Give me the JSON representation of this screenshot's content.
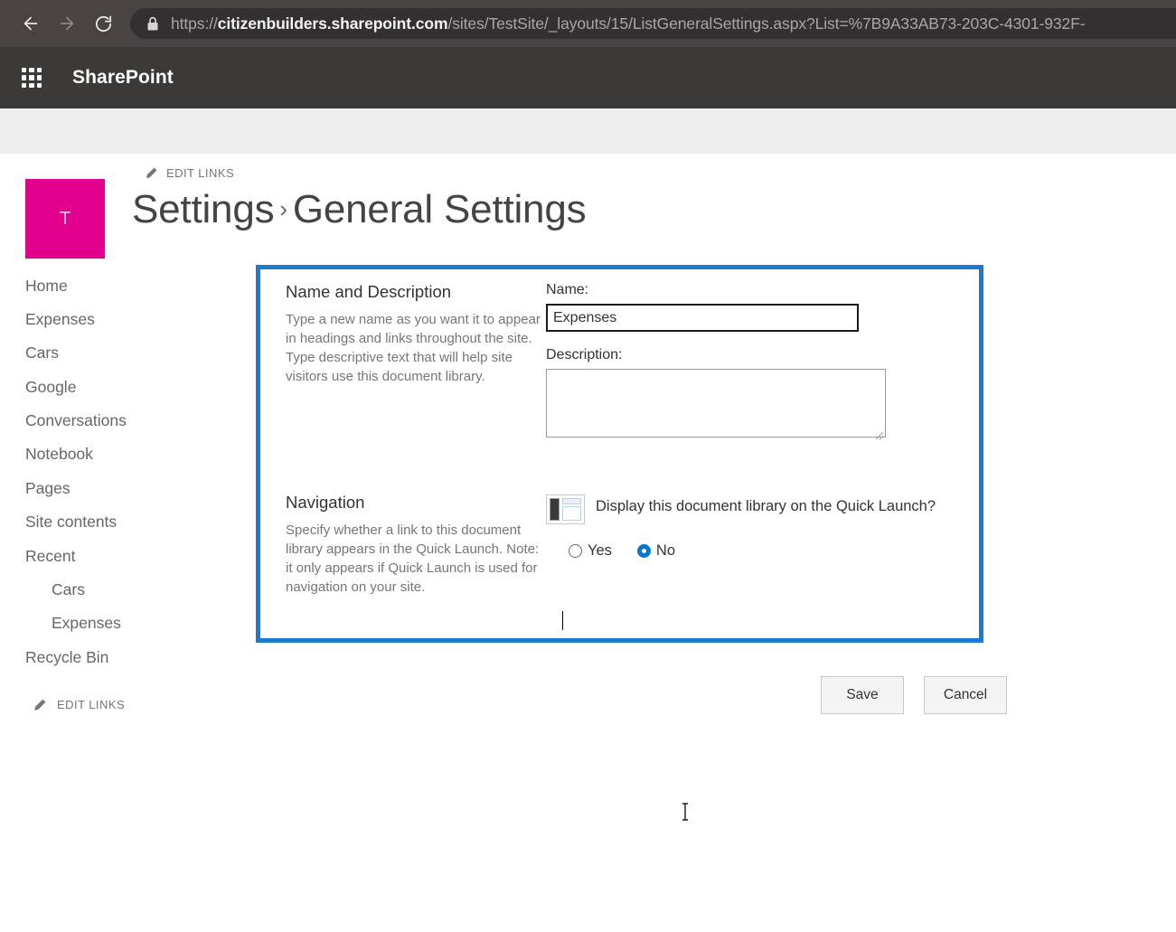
{
  "browser": {
    "back_icon": "arrow-left-icon",
    "forward_icon": "arrow-right-icon",
    "reload_icon": "reload-icon",
    "lock_icon": "lock-icon",
    "url_scheme": "https://",
    "url_host": "citizenbuilders.sharepoint.com",
    "url_path": "/sites/TestSite/_layouts/15/ListGeneralSettings.aspx?List=%7B9A33AB73-203C-4301-932F-",
    "url_full": "https://citizenbuilders.sharepoint.com/sites/TestSite/_layouts/15/ListGeneralSettings.aspx?List=%7B9A33AB73-203C-4301-932F-"
  },
  "suite_bar": {
    "waffle_icon": "app-launcher-waffle-icon",
    "title": "SharePoint",
    "background": "#3b3a39"
  },
  "page_header": {
    "site_logo_letter": "T",
    "site_logo_color": "#e3008c",
    "edit_links_label": "EDIT LINKS",
    "pencil_icon": "pencil-icon",
    "breadcrumb_parent": "Settings",
    "breadcrumb_separator": "›",
    "breadcrumb_current": "General Settings"
  },
  "quick_launch": {
    "items": [
      {
        "label": "Home",
        "child": false
      },
      {
        "label": "Expenses",
        "child": false
      },
      {
        "label": "Cars",
        "child": false
      },
      {
        "label": "Google",
        "child": false
      },
      {
        "label": "Conversations",
        "child": false
      },
      {
        "label": "Notebook",
        "child": false
      },
      {
        "label": "Pages",
        "child": false
      },
      {
        "label": "Site contents",
        "child": false
      },
      {
        "label": "Recent",
        "child": false
      },
      {
        "label": "Cars",
        "child": true
      },
      {
        "label": "Expenses",
        "child": true
      },
      {
        "label": "Recycle Bin",
        "child": false
      }
    ],
    "edit_links_label": "EDIT LINKS",
    "pencil_icon": "pencil-icon"
  },
  "form": {
    "highlight_color": "#1b7ad1",
    "name_section": {
      "title": "Name and Description",
      "description": "Type a new name as you want it to appear in headings and links throughout the site. Type descriptive text that will help site visitors use this document library.",
      "name_label": "Name:",
      "name_value": "Expenses",
      "name_placeholder": "",
      "description_label": "Description:",
      "description_value": "",
      "description_placeholder": ""
    },
    "navigation_section": {
      "title": "Navigation",
      "description": "Specify whether a link to this document library appears in the Quick Launch. Note: it only appears if Quick Launch is used for navigation on your site.",
      "thumb_icon": "quick-launch-layout-icon",
      "question": "Display this document library on the Quick Launch?",
      "options": [
        {
          "label": "Yes",
          "selected": false
        },
        {
          "label": "No",
          "selected": true
        }
      ],
      "selected_value": "No",
      "radio_accent": "#0078d4"
    }
  },
  "actions": {
    "save_label": "Save",
    "cancel_label": "Cancel"
  }
}
